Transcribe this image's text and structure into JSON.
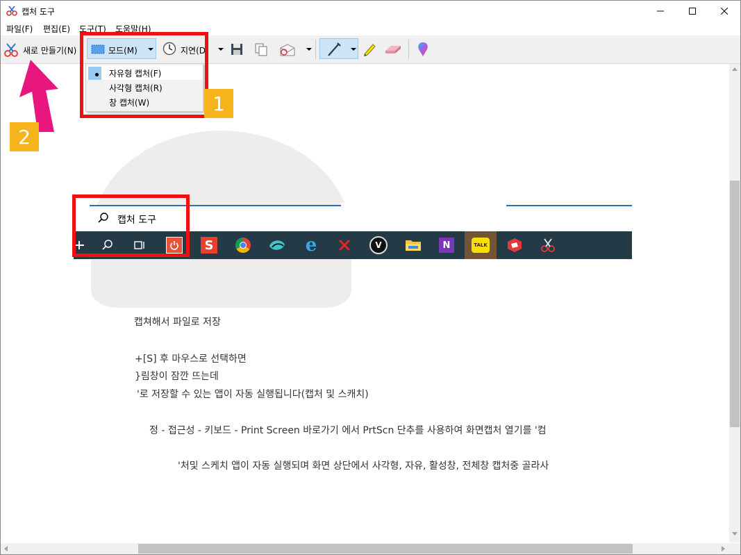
{
  "window": {
    "title": "캡처 도구"
  },
  "menu": [
    "파일(F)",
    "편집(E)",
    "도구(T)",
    "도움말(H)"
  ],
  "toolbar": {
    "new_label": "새로 만들기(N)",
    "mode_label": "모드(M)",
    "delay_label": "지연(D)"
  },
  "mode_menu": [
    {
      "label": "자유형 캡처(F)",
      "selected": true
    },
    {
      "label": "사각형 캡처(R)",
      "selected": false
    },
    {
      "label": "창 캡처(W)",
      "selected": false
    }
  ],
  "badges": [
    "1",
    "2"
  ],
  "capture": {
    "search_text": "캡처 도구",
    "taskbar_icons": [
      "start-icon",
      "search-icon",
      "task-view-icon",
      "power-app-icon",
      "s-app-icon",
      "chrome-icon",
      "fish-app-icon",
      "ie-icon",
      "x-app-icon",
      "v-app-icon",
      "folder-icon",
      "onenote-icon",
      "kakaotalk-icon",
      "sketchup-icon",
      "snipping-tool-icon"
    ],
    "kakao_label": "TALK",
    "lines": [
      "캡쳐해서 파일로 저장",
      "+[S] 후 마우스로 선택하면",
      "}림창이 잠깐 뜨는데",
      "'로 저장할 수 있는 앱이 자동 실행됩니다(캡처 및 스캐치)",
      "정 - 접근성 - 키보드 - Print Screen 바로가기 에서 PrtScn 단추를 사용하여 화면캡처 열기를 '컴",
      "'처및 스케치 앱이 자동 실행되며 화면 상단에서 사각형, 자유, 활성창, 전체창 캡처중 골라사"
    ]
  },
  "colors": {
    "highlight": "#cce4f7",
    "red_box": "#ee1111",
    "badge": "#f5b31c",
    "arrow": "#e8167e",
    "taskbar": "#243a46"
  }
}
